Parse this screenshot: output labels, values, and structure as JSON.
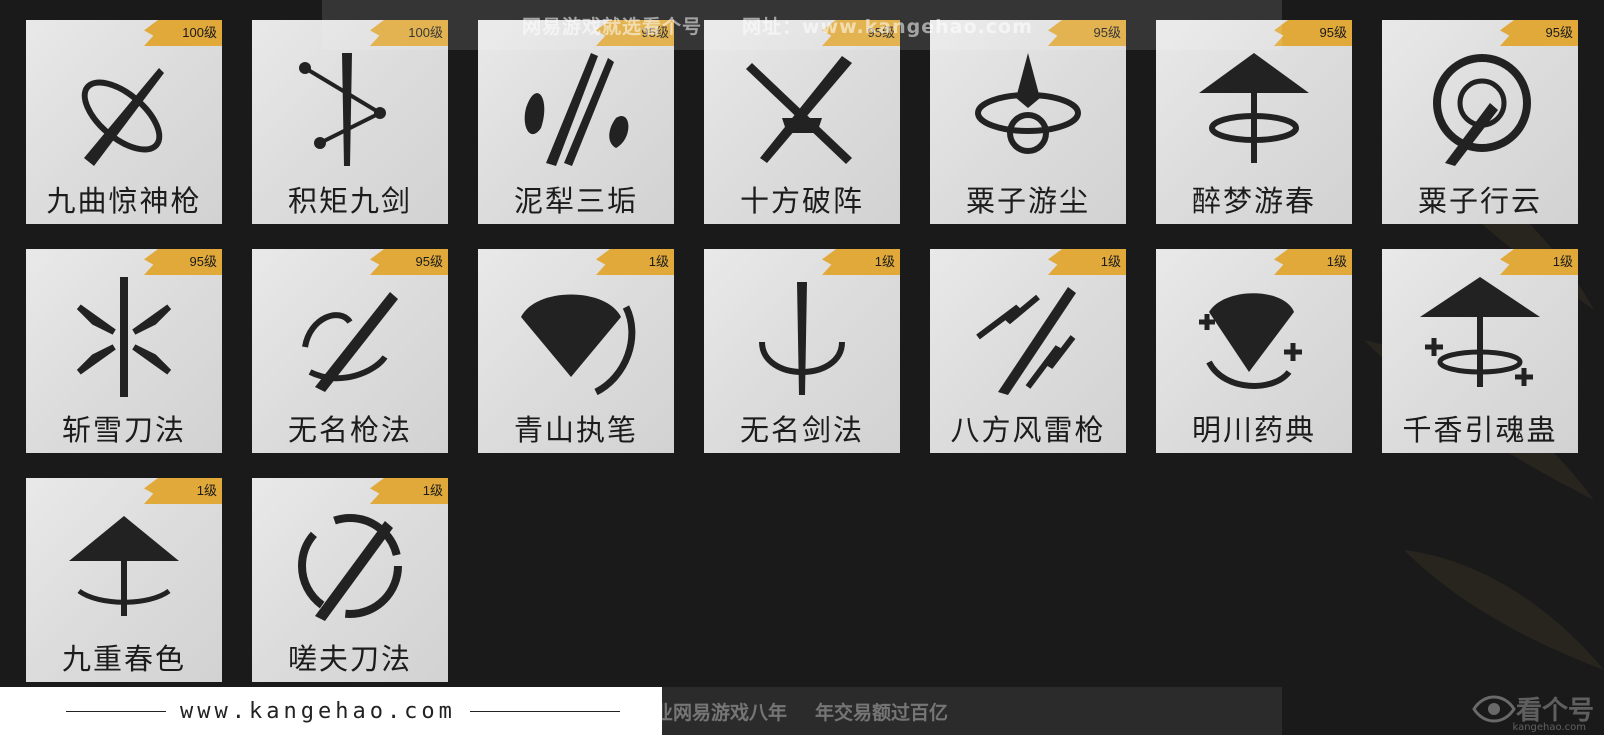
{
  "banner": {
    "site": "网易游戏就选看个号",
    "url": "网址：www.kangehao.com"
  },
  "skills": [
    {
      "name": "九曲惊神枪",
      "level": "100级",
      "icon": "spear-swirl-icon"
    },
    {
      "name": "积矩九剑",
      "level": "100级",
      "icon": "sword-constellation-icon"
    },
    {
      "name": "泥犁三垢",
      "level": "95级",
      "icon": "flame-blades-icon"
    },
    {
      "name": "十方破阵",
      "level": "95级",
      "icon": "crossed-swords-icon"
    },
    {
      "name": "粟子游尘",
      "level": "95级",
      "icon": "spear-vortex-icon"
    },
    {
      "name": "醉梦游春",
      "level": "95级",
      "icon": "umbrella-swirl-icon"
    },
    {
      "name": "粟子行云",
      "level": "95级",
      "icon": "spear-circle-icon"
    },
    {
      "name": "斩雪刀法",
      "level": "95级",
      "icon": "snow-blade-icon"
    },
    {
      "name": "无名枪法",
      "level": "95级",
      "icon": "spear-slash-icon"
    },
    {
      "name": "青山执笔",
      "level": "1级",
      "icon": "fan-icon"
    },
    {
      "name": "无名剑法",
      "level": "1级",
      "icon": "sword-ring-icon"
    },
    {
      "name": "八方风雷枪",
      "level": "1级",
      "icon": "lightning-spear-icon"
    },
    {
      "name": "明川药典",
      "level": "1级",
      "icon": "fan-plus-icon"
    },
    {
      "name": "千香引魂蛊",
      "level": "1级",
      "icon": "umbrella-plus-icon"
    },
    {
      "name": "九重春色",
      "level": "1级",
      "icon": "umbrella-spin-icon"
    },
    {
      "name": "嗟夫刀法",
      "level": "1级",
      "icon": "blade-circle-icon"
    }
  ],
  "footer": {
    "url": "www.kangehao.com",
    "slogan_a": "看个号专业网易游戏八年",
    "slogan_b": "年交易额过百亿",
    "logo": "看个号",
    "logo_sub": "kangehao.com"
  },
  "colors": {
    "badge": "#e0a93a",
    "background": "#1a1a1a",
    "tile": "#dcdcdc"
  }
}
